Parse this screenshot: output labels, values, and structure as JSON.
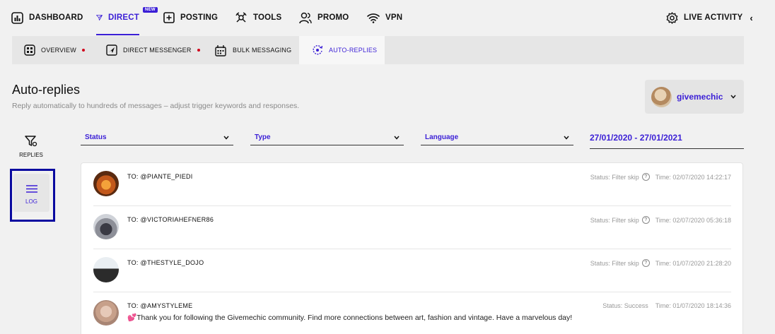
{
  "nav": {
    "items": [
      {
        "label": "DASHBOARD",
        "icon": "dashboard-icon"
      },
      {
        "label": "DIRECT",
        "icon": "send-icon",
        "badge": "NEW"
      },
      {
        "label": "POSTING",
        "icon": "plus-square-icon"
      },
      {
        "label": "TOOLS",
        "icon": "tools-icon"
      },
      {
        "label": "PROMO",
        "icon": "users-icon"
      },
      {
        "label": "VPN",
        "icon": "wifi-icon"
      }
    ],
    "live_activity": "LIVE ACTIVITY",
    "accent": "#3b1fd6"
  },
  "subnav": {
    "items": [
      {
        "label": "OVERVIEW",
        "icon": "grid-icon"
      },
      {
        "label": "DIRECT MESSENGER",
        "icon": "message-icon"
      },
      {
        "label": "BULK MESSAGING",
        "icon": "calendar-icon"
      },
      {
        "label": "AUTO-REPLIES",
        "icon": "auto-reply-icon"
      }
    ]
  },
  "header": {
    "title": "Auto-replies",
    "subtitle": "Reply automatically to hundreds of messages – adjust trigger keywords and responses."
  },
  "account": {
    "name": "givemechic"
  },
  "side": {
    "replies": "REPLIES",
    "log": "LOG"
  },
  "filters": {
    "status": "Status",
    "type": "Type",
    "language": "Language",
    "date_range": "27/01/2020 - 27/01/2021"
  },
  "log": [
    {
      "to": "TO: @PIANTE_PIEDI",
      "status": "Status: Filter skip",
      "time": "Time: 02/07/2020 14:22:17",
      "message": ""
    },
    {
      "to": "TO: @VICTORIAHEFNER86",
      "status": "Status: Filter skip",
      "time": "Time: 02/07/2020 05:36:18",
      "message": ""
    },
    {
      "to": "TO: @THESTYLE_DOJO",
      "status": "Status: Filter skip",
      "time": "Time: 01/07/2020 21:28:20",
      "message": ""
    },
    {
      "to": "TO: @AMYSTYLEME",
      "status": "Status: Success",
      "time": "Time: 01/07/2020 18:14:36",
      "message": "💕Thank you for following the Givemechic community. Find more connections between art, fashion and vintage. Have a marvelous day!"
    }
  ]
}
